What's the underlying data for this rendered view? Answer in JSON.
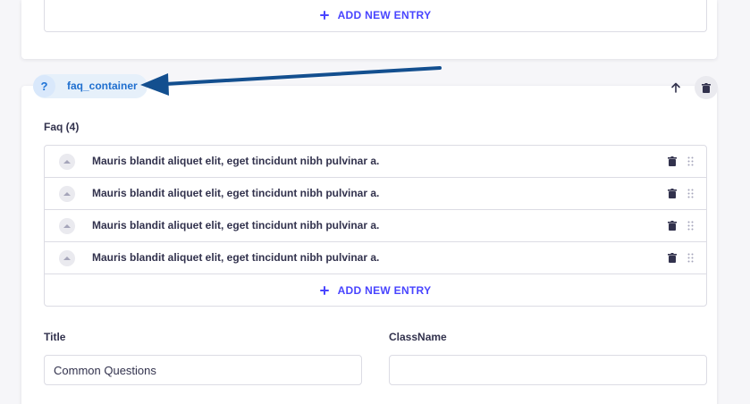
{
  "top_section": {
    "add_entry_label": "ADD NEW ENTRY"
  },
  "component": {
    "name": "faq_container",
    "help_glyph": "?",
    "actions": {
      "move_up_icon": "arrow-up-icon",
      "delete_icon": "trash-icon"
    }
  },
  "faq": {
    "label": "Faq (4)",
    "items": [
      {
        "text": "Mauris blandit aliquet elit, eget tincidunt nibh pulvinar a."
      },
      {
        "text": "Mauris blandit aliquet elit, eget tincidunt nibh pulvinar a."
      },
      {
        "text": "Mauris blandit aliquet elit, eget tincidunt nibh pulvinar a."
      },
      {
        "text": "Mauris blandit aliquet elit, eget tincidunt nibh pulvinar a."
      }
    ],
    "add_entry_label": "ADD NEW ENTRY"
  },
  "fields": {
    "title": {
      "label": "Title",
      "value": "Common Questions",
      "placeholder": ""
    },
    "classname": {
      "label": "ClassName",
      "value": "",
      "placeholder": ""
    }
  },
  "colors": {
    "primary": "#4945ff",
    "annotation_arrow": "#134f8f",
    "pill_bg": "#e6f0fa",
    "border": "#dcdce4"
  }
}
